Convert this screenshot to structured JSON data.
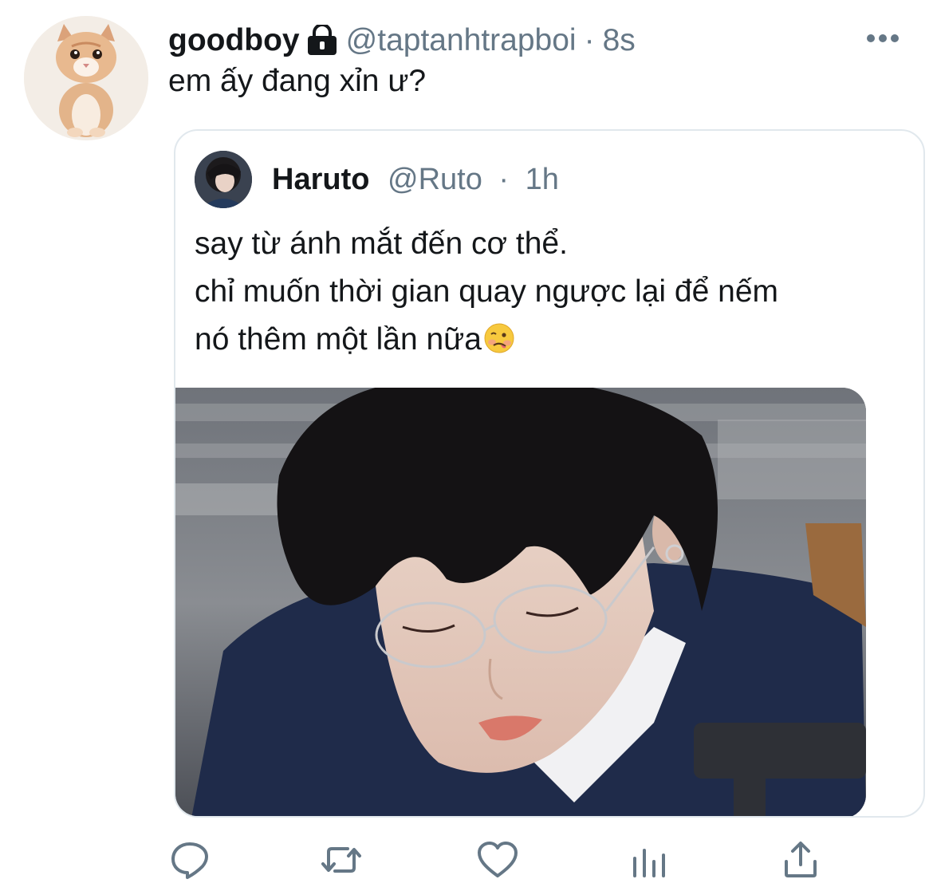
{
  "tweet": {
    "display_name": "goodboy",
    "handle": "@taptanhtrapboi",
    "separator": "·",
    "time": "8s",
    "text": "em ấy đang xỉn ư?",
    "avatar_icon": "kitten-avatar",
    "protected_icon": "lock-icon",
    "more_icon": "more-horizontal-icon"
  },
  "quote": {
    "display_name": "Haruto",
    "handle": "@Ruto",
    "separator": "·",
    "time": "1h",
    "lines": [
      "say từ ánh mắt đến cơ thể.",
      "chỉ muốn thời gian quay ngược lại để nếm",
      "nó thêm một lần nữa"
    ],
    "emoji": "woozy-face",
    "avatar_icon": "profile-photo",
    "photo": "portrait-photo"
  },
  "actions": {
    "reply_icon": "reply-icon",
    "retweet_icon": "retweet-icon",
    "like_icon": "like-icon",
    "analytics_icon": "analytics-icon",
    "share_icon": "share-icon"
  },
  "colors": {
    "primary_text": "#14171a",
    "secondary_text": "#657786",
    "border": "#e1e8ed"
  }
}
